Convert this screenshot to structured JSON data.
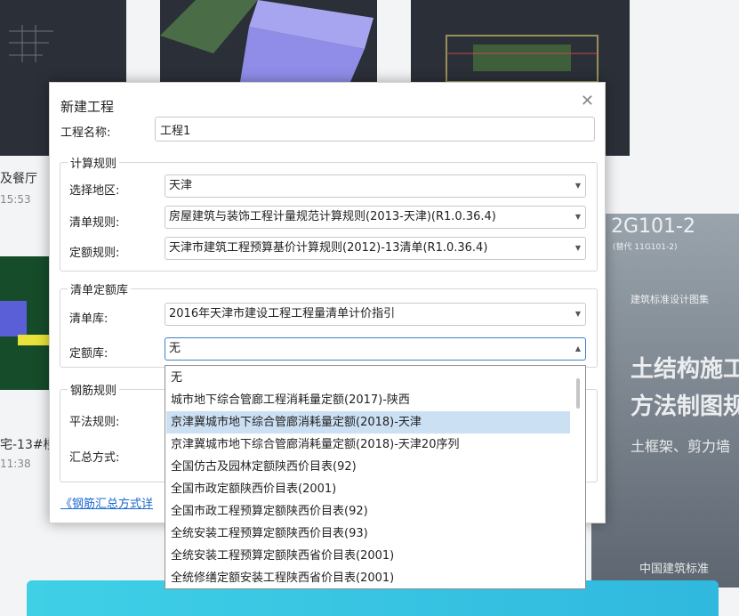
{
  "background": {
    "card1_title": "及餐厅",
    "card1_time": "15:53",
    "card2_title": "宅-13#楼",
    "card2_time": "11:38",
    "book_line1": "2G101-2",
    "book_line2": "(替代 11G101-2)",
    "book_line3": "建筑标准设计图集",
    "book_line4": "土结构施工",
    "book_line5": "方法制图规则",
    "book_line6": "土框架、剪力墙",
    "book_line7": "中国建筑标准"
  },
  "dialog": {
    "title": "新建工程",
    "close_icon": "close-icon",
    "project_name_label": "工程名称:",
    "project_name_value": "工程1",
    "calc_rules": {
      "legend": "计算规则",
      "region_label": "选择地区:",
      "region_value": "天津",
      "bill_rule_label": "清单规则:",
      "bill_rule_value": "房屋建筑与装饰工程计量规范计算规则(2013-天津)(R1.0.36.4)",
      "quota_rule_label": "定额规则:",
      "quota_rule_value": "天津市建筑工程预算基价计算规则(2012)-13清单(R1.0.36.4)"
    },
    "library": {
      "legend": "清单定额库",
      "bill_lib_label": "清单库:",
      "bill_lib_value": "2016年天津市建设工程工程量清单计价指引",
      "quota_lib_label": "定额库:",
      "quota_lib_value": "无"
    },
    "rebar": {
      "legend": "钢筋规则",
      "method_label": "平法规则:",
      "summary_label": "汇总方式:"
    },
    "link_text": "《钢筋汇总方式详"
  },
  "dropdown": {
    "selected_index": 2,
    "items": [
      "无",
      "城市地下综合管廊工程消耗量定额(2017)-陕西",
      "京津冀城市地下综合管廊消耗量定额(2018)-天津",
      "京津冀城市地下综合管廊消耗量定额(2018)-天津20序列",
      "全国仿古及园林定额陕西价目表(92)",
      "全国市政定额陕西价目表(2001)",
      "全国市政工程预算定额陕西价目表(92)",
      "全统安装工程预算定额陕西价目表(93)",
      "全统安装工程预算定额陕西省价目表(2001)",
      "全统修缮定额安装工程陕西省价目表(2001)"
    ]
  },
  "colors": {
    "selection": "#cce0f4",
    "link": "#1c6ad0",
    "banner": "#3fd0e6"
  }
}
